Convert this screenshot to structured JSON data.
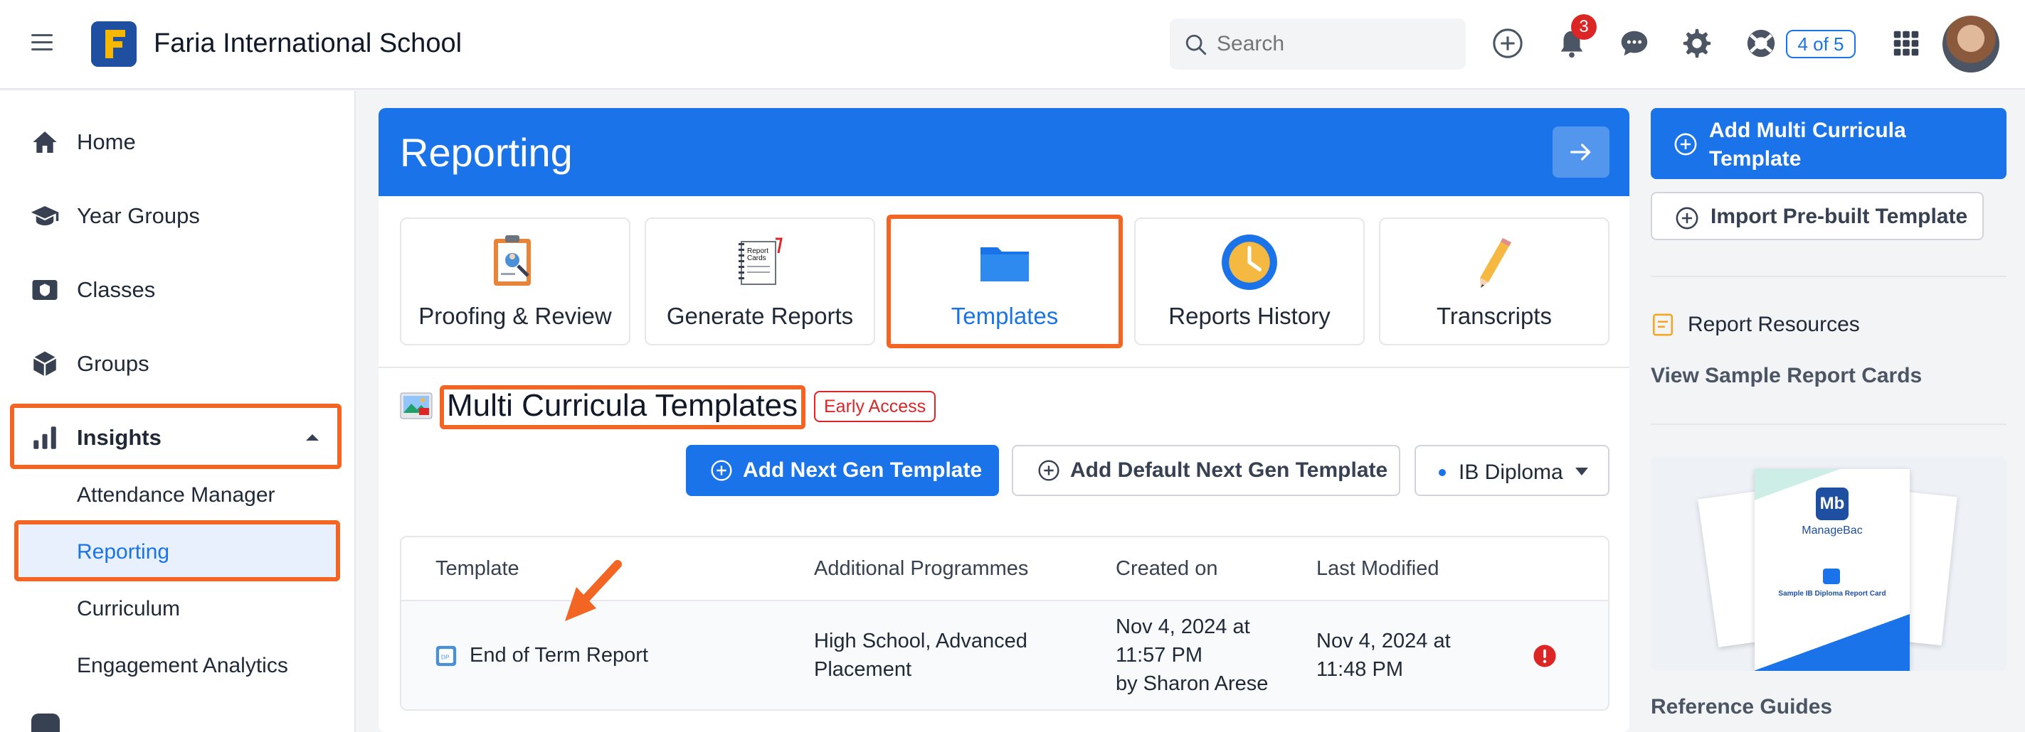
{
  "topbar": {
    "school_name": "Faria International School",
    "search_placeholder": "Search",
    "notification_count": "3",
    "progress_pill": "4 of 5"
  },
  "sidebar": {
    "items": [
      {
        "label": "Home",
        "icon": "home-icon"
      },
      {
        "label": "Year Groups",
        "icon": "graduation-cap-icon"
      },
      {
        "label": "Classes",
        "icon": "classes-icon"
      },
      {
        "label": "Groups",
        "icon": "cube-icon"
      },
      {
        "label": "Insights",
        "icon": "bar-chart-icon"
      }
    ],
    "insights_sub": [
      "Attendance Manager",
      "Reporting",
      "Curriculum",
      "Engagement Analytics"
    ]
  },
  "main": {
    "title": "Reporting",
    "tiles": [
      {
        "label": "Proofing & Review",
        "icon": "proofing-icon"
      },
      {
        "label": "Generate Reports",
        "icon": "report-cards-icon"
      },
      {
        "label": "Templates",
        "icon": "folder-icon"
      },
      {
        "label": "Reports History",
        "icon": "clock-icon"
      },
      {
        "label": "Transcripts",
        "icon": "pencil-icon"
      }
    ],
    "section_title": "Multi Curricula Templates",
    "section_badge": "Early Access",
    "add_next_gen": "Add Next Gen Template",
    "add_default_next_gen": "Add Default Next Gen Template",
    "programme_select": "IB Diploma",
    "table": {
      "headers": [
        "Template",
        "Additional Programmes",
        "Created on",
        "Last Modified"
      ],
      "rows": [
        {
          "template": "End of Term Report",
          "programmes_line1": "High School, Advanced",
          "programmes_line2": "Placement",
          "created_line1": "Nov 4, 2024 at",
          "created_line2": "11:57 PM",
          "created_line3": "by Sharon Arese",
          "modified_line1": "Nov 4, 2024 at",
          "modified_line2": "11:48 PM"
        }
      ]
    }
  },
  "right_panel": {
    "add_multi_line1": "Add Multi Curricula",
    "add_multi_line2": "Template",
    "import_prebuilt": "Import Pre-built Template",
    "resources_title": "Report Resources",
    "view_samples": "View Sample Report Cards",
    "preview_brand": "ManageBac",
    "preview_caption": "Sample IB Diploma Report Card",
    "reference_guides": "Reference Guides"
  },
  "colors": {
    "accent": "#1a73e8",
    "highlight": "#f26522",
    "alert": "#dc2626"
  }
}
